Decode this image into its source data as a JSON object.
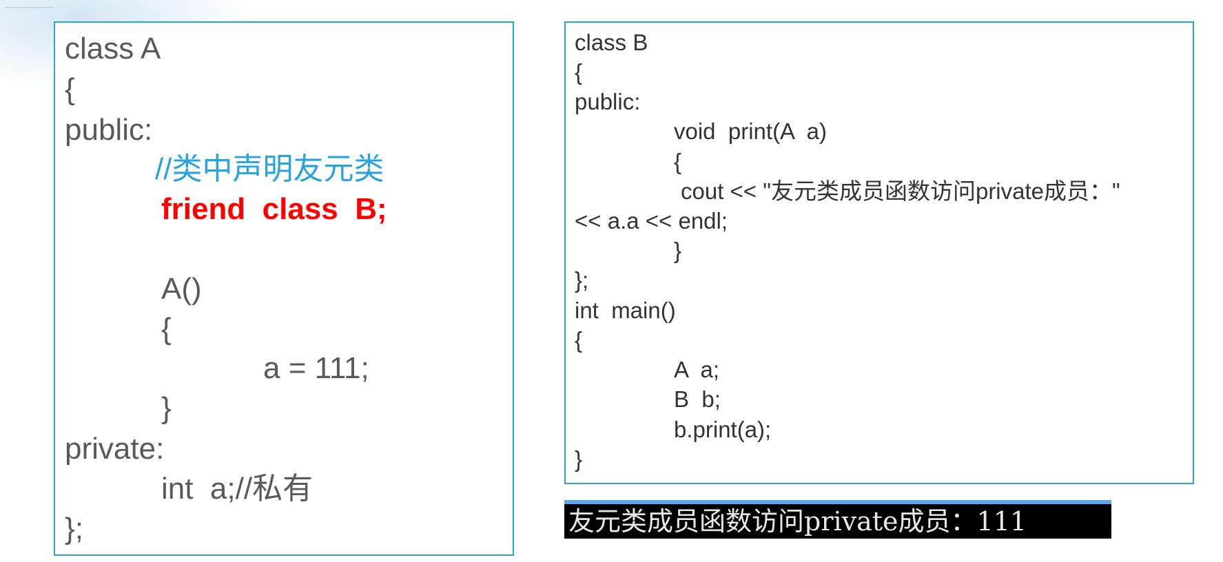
{
  "panel_a": {
    "lines": [
      "class A",
      "{",
      "public:",
      "//类中声明友元类",
      "friend  class  B;",
      "A()",
      "{",
      "a = 111;",
      "}",
      "private:",
      "int  a;//私有",
      "};"
    ]
  },
  "panel_b": {
    "lines": [
      "class B",
      "{",
      "public:",
      "void  print(A  a)",
      "{",
      "cout << \"友元类成员函数访问private成员：\"",
      "<< a.a << endl;",
      "}",
      "};",
      "int  main()",
      "{",
      "A  a;",
      "B  b;",
      "b.print(a);",
      "}"
    ]
  },
  "console": {
    "output": "友元类成员函数访问private成员：111"
  },
  "colors": {
    "border": "#29a3d9",
    "comment": "#29a3d9",
    "highlight": "#ff0000",
    "code_text": "#595959",
    "console_bg": "#000000",
    "console_bar": "#5fa8e8"
  }
}
